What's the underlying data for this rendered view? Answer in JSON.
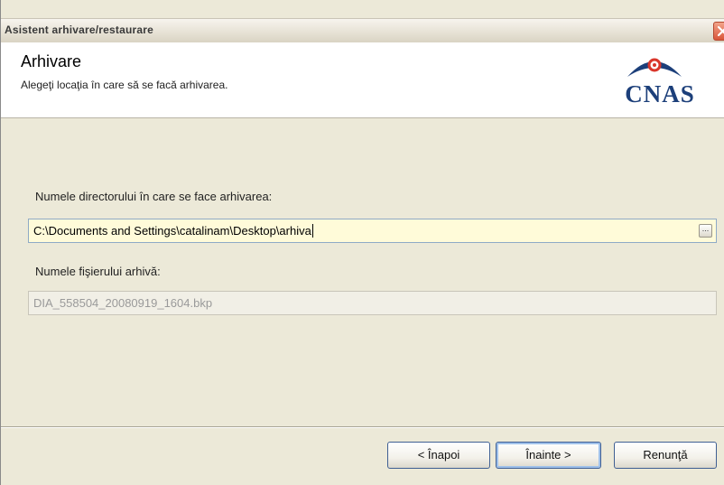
{
  "window": {
    "title": "Asistent arhivare/restaurare"
  },
  "header": {
    "title": "Arhivare",
    "subtitle": "Alegeţi locaţia în care să se facă arhivarea.",
    "logo_text": "CNAS"
  },
  "form": {
    "directory_label": "Numele directorului în care se face arhivarea:",
    "directory_value": "C:\\Documents and Settings\\catalinam\\Desktop\\arhiva",
    "browse_label": "...",
    "file_label": "Numele fişierului arhivă:",
    "file_value": "DIA_558504_20080919_1604.bkp"
  },
  "buttons": {
    "back": "< Înapoi",
    "next": "Înainte >",
    "cancel": "Renunţă"
  },
  "colors": {
    "logo_blue": "#1c3f7a",
    "logo_red": "#d9362b",
    "input_highlight": "#fffbd9"
  }
}
